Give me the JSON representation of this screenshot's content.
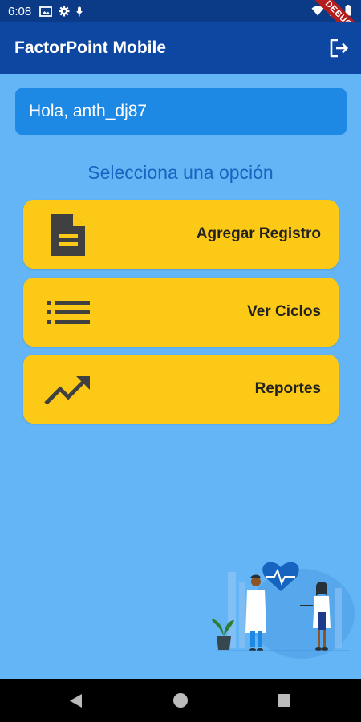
{
  "status_bar": {
    "time": "6:08",
    "debug_label": "DEBUG",
    "icons": [
      "photo-icon",
      "gear-icon",
      "mic-icon",
      "wifi-icon",
      "signal-icon",
      "battery-icon"
    ]
  },
  "app_bar": {
    "title": "FactorPoint Mobile",
    "logout_icon": "logout-icon"
  },
  "greeting": "Hola, anth_dj87",
  "subtitle": "Selecciona una opción",
  "options": [
    {
      "label": "Agregar Registro",
      "icon": "document-icon"
    },
    {
      "label": "Ver Ciclos",
      "icon": "list-icon"
    },
    {
      "label": "Reportes",
      "icon": "trending-up-icon"
    }
  ],
  "colors": {
    "background": "#64b5f6",
    "app_bar": "#0d47a1",
    "greeting_card": "#1e88e5",
    "option_card": "#fcca16",
    "subtitle_text": "#1565c0"
  },
  "nav_bar": {
    "icons": [
      "back-icon",
      "home-icon",
      "recent-apps-icon"
    ]
  }
}
